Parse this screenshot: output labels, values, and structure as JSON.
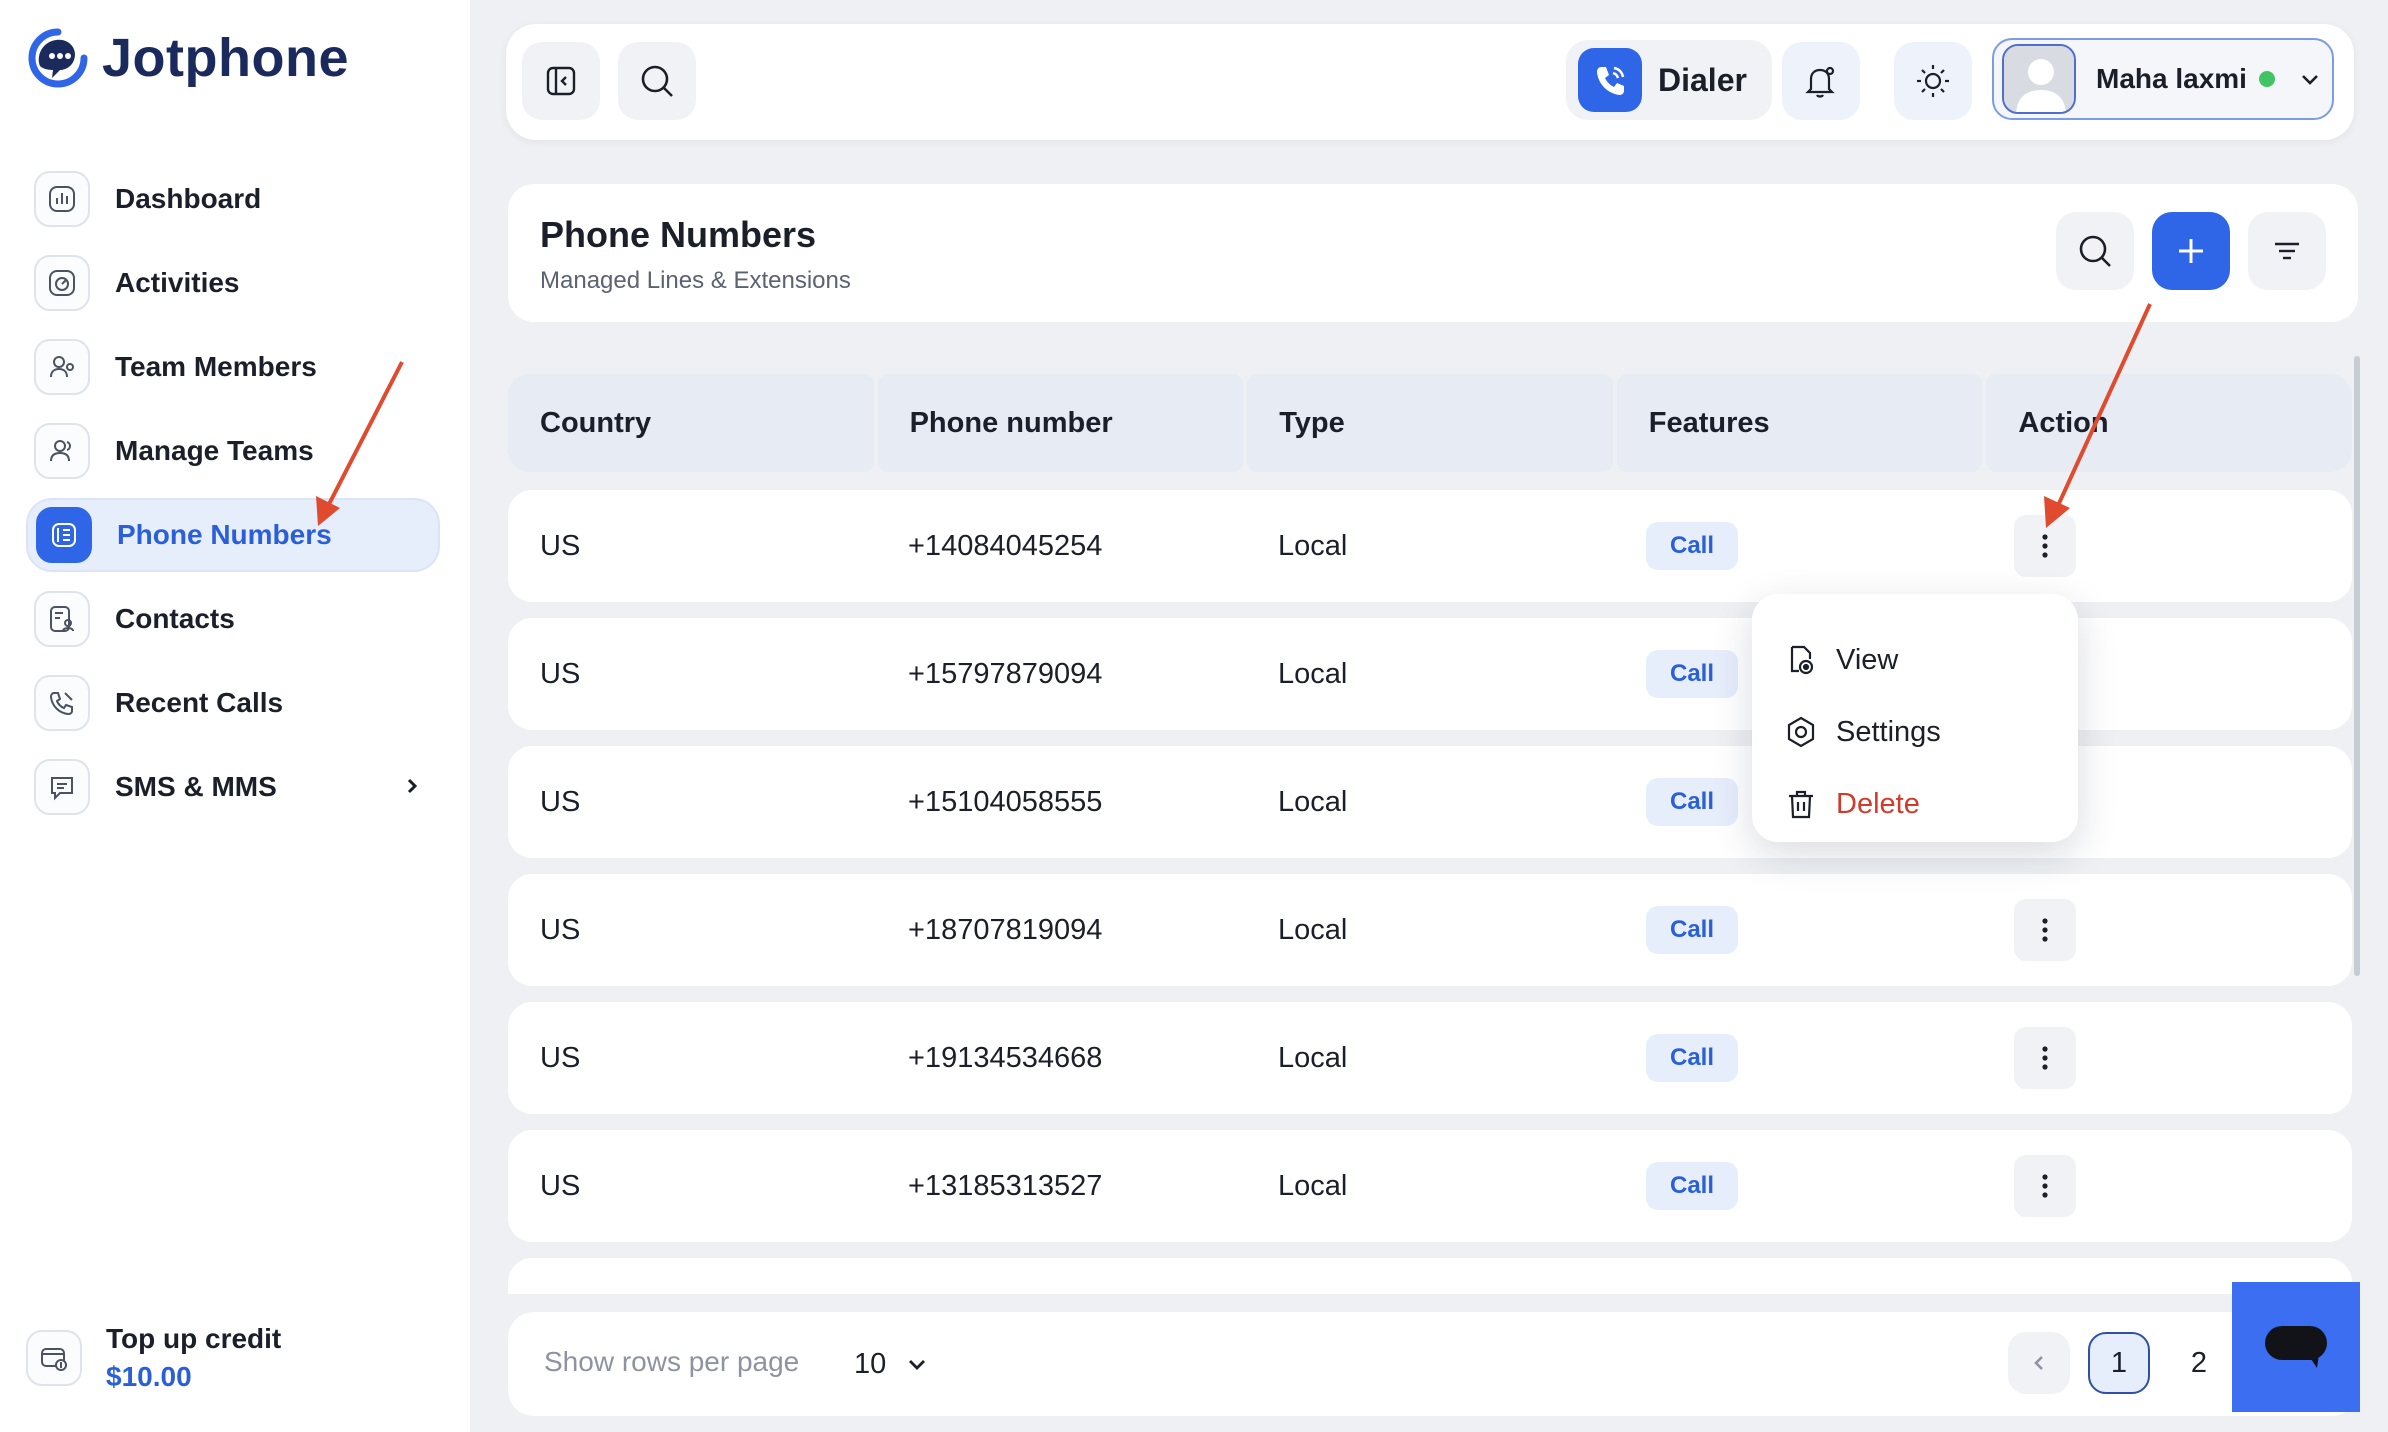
{
  "brand": {
    "name": "Jotphone"
  },
  "sidebar": {
    "items": [
      {
        "label": "Dashboard",
        "icon": "dashboard-icon"
      },
      {
        "label": "Activities",
        "icon": "activities-icon"
      },
      {
        "label": "Team Members",
        "icon": "team-members-icon"
      },
      {
        "label": "Manage Teams",
        "icon": "manage-teams-icon"
      },
      {
        "label": "Phone Numbers",
        "icon": "phone-numbers-icon",
        "active": true
      },
      {
        "label": "Contacts",
        "icon": "contacts-icon"
      },
      {
        "label": "Recent Calls",
        "icon": "recent-calls-icon"
      },
      {
        "label": "SMS & MMS",
        "icon": "sms-icon",
        "has_submenu": true
      }
    ],
    "credit": {
      "label": "Top up credit",
      "amount": "$10.00"
    }
  },
  "header": {
    "dialer_label": "Dialer",
    "user": {
      "name": "Maha laxmi",
      "status": "online"
    }
  },
  "page": {
    "title": "Phone Numbers",
    "subtitle": "Managed Lines & Extensions"
  },
  "table": {
    "columns": [
      "Country",
      "Phone number",
      "Type",
      "Features",
      "Action"
    ],
    "rows": [
      {
        "country": "US",
        "phone": "+14084045254",
        "type": "Local",
        "feature": "Call"
      },
      {
        "country": "US",
        "phone": "+15797879094",
        "type": "Local",
        "feature": "Call"
      },
      {
        "country": "US",
        "phone": "+15104058555",
        "type": "Local",
        "feature": "Call"
      },
      {
        "country": "US",
        "phone": "+18707819094",
        "type": "Local",
        "feature": "Call"
      },
      {
        "country": "US",
        "phone": "+19134534668",
        "type": "Local",
        "feature": "Call"
      },
      {
        "country": "US",
        "phone": "+13185313527",
        "type": "Local",
        "feature": "Call"
      }
    ]
  },
  "action_menu": {
    "items": [
      {
        "label": "View",
        "icon": "view-icon"
      },
      {
        "label": "Settings",
        "icon": "settings-icon"
      },
      {
        "label": "Delete",
        "icon": "trash-icon",
        "danger": true
      }
    ]
  },
  "footer": {
    "rows_label": "Show rows per page",
    "rows_value": "10",
    "pages": [
      "1",
      "2"
    ],
    "current_page": "1"
  },
  "colors": {
    "accent": "#2f66e8",
    "danger": "#d23a2b",
    "online": "#43c464",
    "annotation_arrow": "#e04a2f"
  }
}
